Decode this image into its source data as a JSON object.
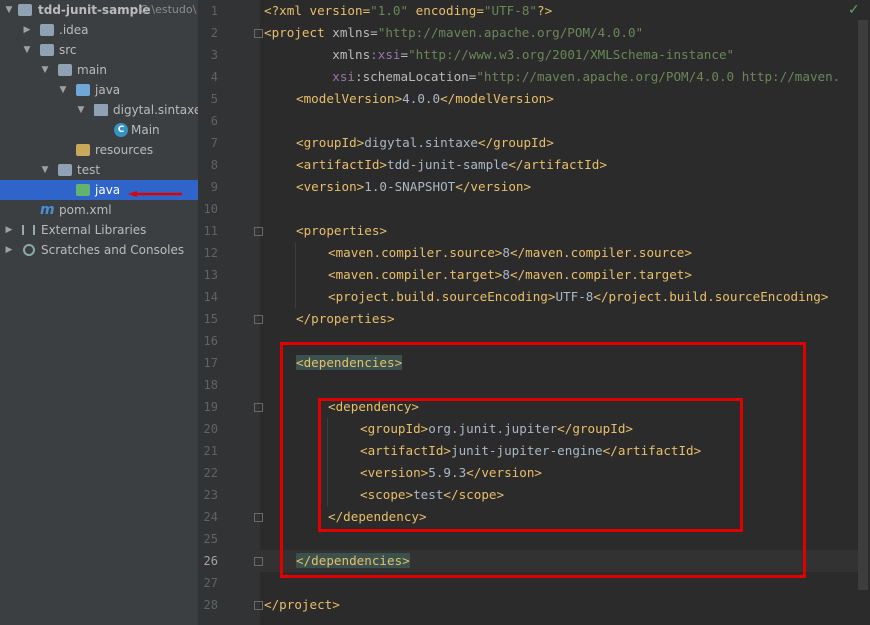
{
  "project_tree": {
    "items": [
      {
        "label": "tdd-junit-sample",
        "hint": "C:\\estudo\\"
      },
      {
        "label": ".idea"
      },
      {
        "label": "src"
      },
      {
        "label": "main"
      },
      {
        "label": "java"
      },
      {
        "label": "digytal.sintaxe"
      },
      {
        "label": "Main"
      },
      {
        "label": "resources"
      },
      {
        "label": "test"
      },
      {
        "label": "java"
      },
      {
        "label": "pom.xml"
      },
      {
        "label": "External Libraries"
      },
      {
        "label": "Scratches and Consoles"
      }
    ]
  },
  "editor": {
    "line_numbers": [
      "1",
      "2",
      "3",
      "4",
      "5",
      "6",
      "7",
      "8",
      "9",
      "10",
      "11",
      "12",
      "13",
      "14",
      "15",
      "16",
      "17",
      "18",
      "19",
      "20",
      "21",
      "22",
      "23",
      "24",
      "25",
      "26",
      "27",
      "28"
    ],
    "current_line": "26",
    "t": {
      "l1a": "<?xml version=",
      "l1b": "\"1.0\"",
      "l1c": " encoding=",
      "l1d": "\"UTF-8\"",
      "l1e": "?>",
      "l2a": "<project ",
      "l2b": "xmlns=",
      "l2c": "\"http://maven.apache.org/POM/4.0.0\"",
      "l3a": "         xmlns",
      "l3b": ":xsi",
      "l3c": "=",
      "l3d": "\"http://www.w3.org/2001/XMLSchema-instance\"",
      "l4a": "         xsi",
      "l4b": ":schemaLocation=",
      "l4c": "\"http://maven.apache.org/POM/4.0.0 http://maven.",
      "l5a": "<modelVersion>",
      "l5b": "4.0.0",
      "l5c": "</modelVersion>",
      "l7a": "<groupId>",
      "l7b": "digytal.sintaxe",
      "l7c": "</groupId>",
      "l8a": "<artifactId>",
      "l8b": "tdd-junit-sample",
      "l8c": "</artifactId>",
      "l9a": "<version>",
      "l9b": "1.0-SNAPSHOT",
      "l9c": "</version>",
      "l11": "<properties>",
      "l12a": "<maven.compiler.source>",
      "l12b": "8",
      "l12c": "</maven.compiler.source>",
      "l13a": "<maven.compiler.target>",
      "l13b": "8",
      "l13c": "</maven.compiler.target>",
      "l14a": "<project.build.sourceEncoding>",
      "l14b": "UTF-8",
      "l14c": "</project.build.sourceEncoding>",
      "l15": "</properties>",
      "l17": "<dependencies>",
      "l19": "<dependency>",
      "l20a": "<groupId>",
      "l20b": "org.junit.jupiter",
      "l20c": "</groupId>",
      "l21a": "<artifactId>",
      "l21b": "junit-jupiter-engine",
      "l21c": "</artifactId>",
      "l22a": "<version>",
      "l22b": "5.9.3",
      "l22c": "</version>",
      "l23a": "<scope>",
      "l23b": "test",
      "l23c": "</scope>",
      "l24": "</dependency>",
      "l26": "</dependencies>",
      "l28": "</project>"
    }
  },
  "colors": {
    "selection": "#2f65ca",
    "annotation": "#e00000",
    "tag": "#e8bf6a",
    "string": "#6a8759"
  }
}
